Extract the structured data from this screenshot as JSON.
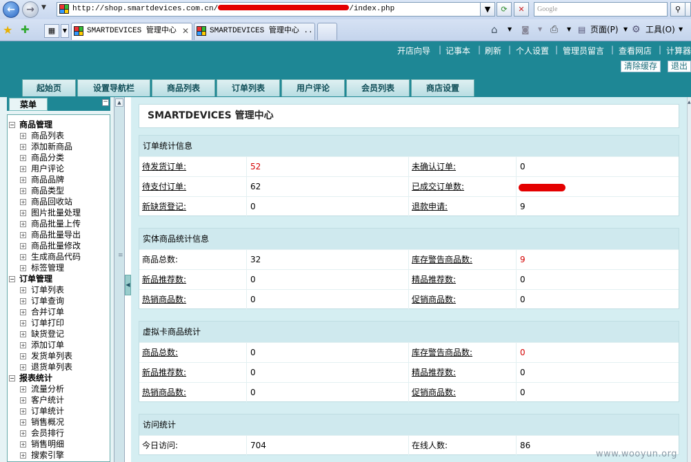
{
  "browser": {
    "address": "http://shop.smartdevices.com.cn/",
    "address_tail": "/index.php",
    "search_placeholder": "Google",
    "tabs": [
      {
        "label": "SMARTDEVICES 管理中心"
      },
      {
        "label": "SMARTDEVICES 管理中心 ..."
      }
    ],
    "commands": {
      "page": "页面(P)",
      "tools": "工具(O)"
    }
  },
  "header": {
    "links": [
      "开店向导",
      "记事本",
      "刷新",
      "个人设置",
      "管理员留言",
      "查看网店",
      "计算器"
    ],
    "buttons": [
      "清除缓存",
      "退出"
    ]
  },
  "nav": {
    "tabs": [
      "起始页",
      "设置导航栏",
      "商品列表",
      "订单列表",
      "用户评论",
      "会员列表",
      "商店设置"
    ]
  },
  "menu": {
    "title": "菜单",
    "groups": [
      {
        "label": "商品管理",
        "items": [
          "商品列表",
          "添加新商品",
          "商品分类",
          "用户评论",
          "商品品牌",
          "商品类型",
          "商品回收站",
          "图片批量处理",
          "商品批量上传",
          "商品批量导出",
          "商品批量修改",
          "生成商品代码",
          "标签管理"
        ]
      },
      {
        "label": "订单管理",
        "items": [
          "订单列表",
          "订单查询",
          "合并订单",
          "订单打印",
          "缺货登记",
          "添加订单",
          "发货单列表",
          "退货单列表"
        ]
      },
      {
        "label": "报表统计",
        "items": [
          "流量分析",
          "客户统计",
          "订单统计",
          "销售概况",
          "会员排行",
          "销售明细",
          "搜索引擎"
        ]
      }
    ]
  },
  "main": {
    "title": "SMARTDEVICES 管理中心",
    "sections": [
      {
        "title": "订单统计信息",
        "rows": [
          [
            {
              "label": "待发货订单:",
              "value": "52",
              "red": true
            },
            {
              "label": "未确认订单:",
              "value": "0"
            }
          ],
          [
            {
              "label": "待支付订单:",
              "value": "62"
            },
            {
              "label": "已成交订单数:",
              "value": "",
              "redacted": true
            }
          ],
          [
            {
              "label": "新缺货登记:",
              "value": "0"
            },
            {
              "label": "退款申请:",
              "value": "9"
            }
          ]
        ]
      },
      {
        "title": "实体商品统计信息",
        "rows": [
          [
            {
              "label": "商品总数:",
              "value": "32",
              "plain": true
            },
            {
              "label": "库存警告商品数:",
              "value": "9",
              "red": true
            }
          ],
          [
            {
              "label": "新品推荐数:",
              "value": "0"
            },
            {
              "label": "精品推荐数:",
              "value": "0"
            }
          ],
          [
            {
              "label": "热销商品数:",
              "value": "0"
            },
            {
              "label": "促销商品数:",
              "value": "0"
            }
          ]
        ]
      },
      {
        "title": "虚拟卡商品统计",
        "rows": [
          [
            {
              "label": "商品总数:",
              "value": "0"
            },
            {
              "label": "库存警告商品数:",
              "value": "0",
              "red": true
            }
          ],
          [
            {
              "label": "新品推荐数:",
              "value": "0"
            },
            {
              "label": "精品推荐数:",
              "value": "0"
            }
          ],
          [
            {
              "label": "热销商品数:",
              "value": "0"
            },
            {
              "label": "促销商品数:",
              "value": "0"
            }
          ]
        ]
      },
      {
        "title": "访问统计",
        "rows": [
          [
            {
              "label": "今日访问:",
              "value": "704",
              "plain": true
            },
            {
              "label": "在线人数:",
              "value": "86",
              "plain": true
            }
          ]
        ]
      }
    ]
  },
  "watermark": "www.wooyun.org"
}
